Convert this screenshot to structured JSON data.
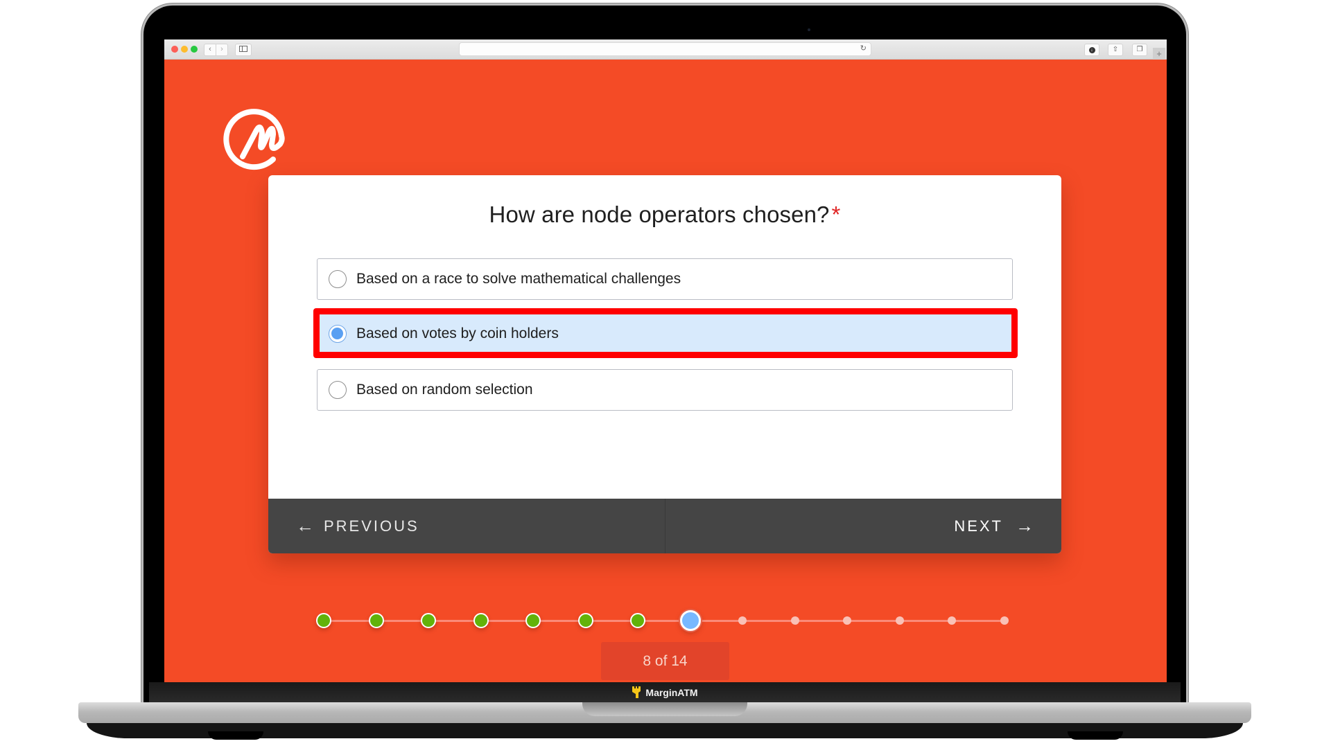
{
  "browser": {
    "address_value": "",
    "back_icon": "‹",
    "forward_icon": "›",
    "reload_icon": "↻",
    "share_icon": "⇧",
    "tabs_icon": "❐",
    "newtab_icon": "+"
  },
  "quiz": {
    "question": "How are node operators chosen?",
    "required_marker": "*",
    "options": [
      {
        "label": "Based on a race to solve mathematical challenges",
        "selected": false
      },
      {
        "label": "Based on votes by coin holders",
        "selected": true
      },
      {
        "label": "Based on random selection",
        "selected": false
      }
    ],
    "previous_label": "PREVIOUS",
    "next_label": "NEXT",
    "previous_icon": "←",
    "next_icon": "→"
  },
  "progress": {
    "current": 8,
    "total": 14,
    "counter_text": "8 of 14"
  },
  "colors": {
    "background": "#F44B26",
    "done_step": "#62b20a",
    "current_step": "#78b8ff",
    "highlight": "#ff0000",
    "selected_option": "#d8eafc"
  },
  "device": {
    "brand_label": "MarginATM"
  }
}
